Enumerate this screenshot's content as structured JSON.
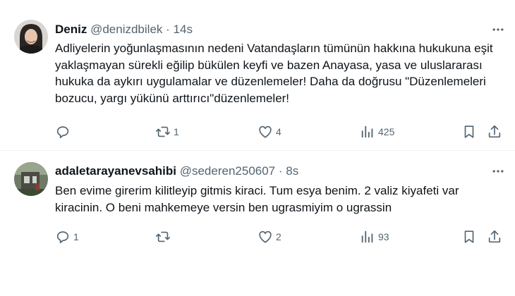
{
  "tweets": [
    {
      "display_name": "Deniz",
      "handle": "@denizdbilek",
      "separator": "·",
      "time": "14s",
      "text": "Adliyelerin yoğunlaşmasının nedeni Vatandaşların tümünün hakkına hukukuna eşit yaklaşmayan sürekli eğilip bükülen keyfi ve bazen Anayasa, yasa ve uluslararası hukuka da aykırı uygulamalar ve düzenlemeler! Daha da doğrusu \"Düzenlemeleri bozucu, yargı yükünü arttırıcı\"düzenlemeler!",
      "reply_count": "",
      "retweet_count": "1",
      "like_count": "4",
      "view_count": "425"
    },
    {
      "display_name": "adaletarayanevsahibi",
      "handle": "@sederen250607",
      "separator": "·",
      "time": "8s",
      "text": "Ben evime girerim kilitleyip gitmis kiraci. Tum esya benim. 2 valiz kiyafeti var kiracinin. O beni mahkemeye versin ben ugrasmiyim o ugrassin",
      "reply_count": "1",
      "retweet_count": "",
      "like_count": "2",
      "view_count": "93"
    }
  ],
  "colors": {
    "text": "#0f1419",
    "secondary": "#536471",
    "divider": "#eff3f4"
  },
  "icons": [
    "more-icon",
    "reply-icon",
    "retweet-icon",
    "like-icon",
    "views-icon",
    "bookmark-icon",
    "share-icon"
  ]
}
